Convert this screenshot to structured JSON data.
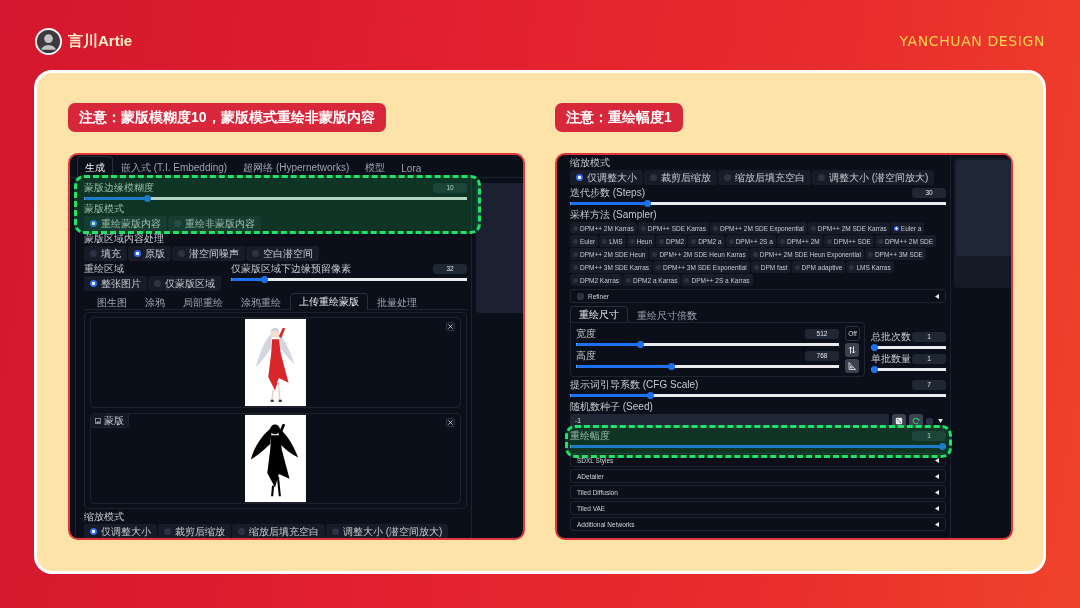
{
  "header": {
    "author": "言川Artie",
    "brand": "YANCHUAN DESIGN"
  },
  "left": {
    "note": "注意：蒙版模糊度10，蒙版模式重绘非蒙版内容",
    "tabs": [
      {
        "label": "生成",
        "selected": true
      },
      {
        "label": "嵌入式 (T.I. Embedding)",
        "selected": false
      },
      {
        "label": "超网络 (Hypernetworks)",
        "selected": false
      },
      {
        "label": "模型",
        "selected": false
      },
      {
        "label": "Lora",
        "selected": false
      }
    ],
    "mask_blur": {
      "label": "蒙版边缘模糊度",
      "value": "10",
      "level": 0.16
    },
    "mask_mode": {
      "label": "蒙版模式",
      "options": [
        {
          "label": "重绘蒙版内容",
          "selected": true
        },
        {
          "label": "重绘非蒙版内容",
          "selected": false
        }
      ]
    },
    "masked_content": {
      "label": "蒙版区域内容处理",
      "options": [
        {
          "label": "填充",
          "selected": false
        },
        {
          "label": "原版",
          "selected": true
        },
        {
          "label": "潜空间噪声",
          "selected": false
        },
        {
          "label": "空白潜空间",
          "selected": false
        }
      ]
    },
    "inpaint_area": {
      "label": "重绘区域",
      "options": [
        {
          "label": "整张图片",
          "selected": true
        },
        {
          "label": "仅蒙版区域",
          "selected": false
        }
      ]
    },
    "padding": {
      "label": "仅蒙版区域下边缘预留像素",
      "value": "32",
      "level": 0.13
    },
    "subtabs": [
      {
        "label": "图生图",
        "selected": false
      },
      {
        "label": "涂鸦",
        "selected": false
      },
      {
        "label": "局部重绘",
        "selected": false
      },
      {
        "label": "涂鸦重绘",
        "selected": false
      },
      {
        "label": "上传重绘蒙版",
        "selected": true
      },
      {
        "label": "批量处理",
        "selected": false
      }
    ],
    "mask_label": "蒙版",
    "resize_mode": {
      "label": "缩放模式",
      "options": [
        {
          "label": "仅调整大小",
          "selected": true
        },
        {
          "label": "裁剪后缩放",
          "selected": false
        },
        {
          "label": "缩放后填充空白",
          "selected": false
        },
        {
          "label": "调整大小 (潜空间放大)",
          "selected": false
        }
      ]
    }
  },
  "right": {
    "note": "注意：重绘幅度1",
    "resize_mode": {
      "label": "缩放模式",
      "options": [
        {
          "label": "仅调整大小",
          "selected": true
        },
        {
          "label": "裁剪后缩放",
          "selected": false
        },
        {
          "label": "缩放后填充空白",
          "selected": false
        },
        {
          "label": "调整大小 (潜空间放大)",
          "selected": false
        }
      ]
    },
    "steps": {
      "label": "迭代步数 (Steps)",
      "value": "30",
      "level": 0.2
    },
    "sampler": {
      "label": "采样方法 (Sampler)",
      "options": [
        {
          "label": "DPM++ 2M Karras",
          "selected": false
        },
        {
          "label": "DPM++ SDE Karras",
          "selected": false
        },
        {
          "label": "DPM++ 2M SDE Exponential",
          "selected": false
        },
        {
          "label": "DPM++ 2M SDE Karras",
          "selected": false
        },
        {
          "label": "Euler a",
          "selected": true
        },
        {
          "label": "Euler",
          "selected": false
        },
        {
          "label": "LMS",
          "selected": false
        },
        {
          "label": "Heun",
          "selected": false
        },
        {
          "label": "DPM2",
          "selected": false
        },
        {
          "label": "DPM2 a",
          "selected": false
        },
        {
          "label": "DPM++ 2S a",
          "selected": false
        },
        {
          "label": "DPM++ 2M",
          "selected": false
        },
        {
          "label": "DPM++ SDE",
          "selected": false
        },
        {
          "label": "DPM++ 2M SDE",
          "selected": false
        },
        {
          "label": "DPM++ 2M SDE Heun",
          "selected": false
        },
        {
          "label": "DPM++ 2M SDE Heun Karras",
          "selected": false
        },
        {
          "label": "DPM++ 2M SDE Heun Exponential",
          "selected": false
        },
        {
          "label": "DPM++ 3M SDE",
          "selected": false
        },
        {
          "label": "DPM++ 3M SDE Karras",
          "selected": false
        },
        {
          "label": "DPM++ 3M SDE Exponential",
          "selected": false
        },
        {
          "label": "DPM fast",
          "selected": false
        },
        {
          "label": "DPM adaptive",
          "selected": false
        },
        {
          "label": "LMS Karras",
          "selected": false
        },
        {
          "label": "DPM2 Karras",
          "selected": false
        },
        {
          "label": "DPM2 a Karras",
          "selected": false
        },
        {
          "label": "DPM++ 2S a Karras",
          "selected": false
        }
      ]
    },
    "refiner": {
      "label": "Refiner",
      "checked": false
    },
    "size_tabs": [
      {
        "label": "重绘尺寸",
        "selected": true
      },
      {
        "label": "重绘尺寸倍数",
        "selected": false
      }
    ],
    "width": {
      "label": "宽度",
      "value": "512",
      "level": 0.24
    },
    "height": {
      "label": "高度",
      "value": "768",
      "level": 0.36
    },
    "off_button": "Off",
    "batch_count": {
      "label": "总批次数",
      "value": "1",
      "level": 0
    },
    "batch_size": {
      "label": "单批数量",
      "value": "1",
      "level": 0
    },
    "cfg": {
      "label": "提示词引导系数 (CFG Scale)",
      "value": "7",
      "level": 0.21
    },
    "seed": {
      "label": "随机数种子 (Seed)",
      "value": "-1",
      "extra_checked": false
    },
    "denoise": {
      "label": "重绘幅度",
      "value": "1",
      "level": 1
    },
    "accordions": [
      "SDXL Styles",
      "ADetailer",
      "Tiled Diffusion",
      "Tiled VAE",
      "Additional Networks"
    ]
  }
}
